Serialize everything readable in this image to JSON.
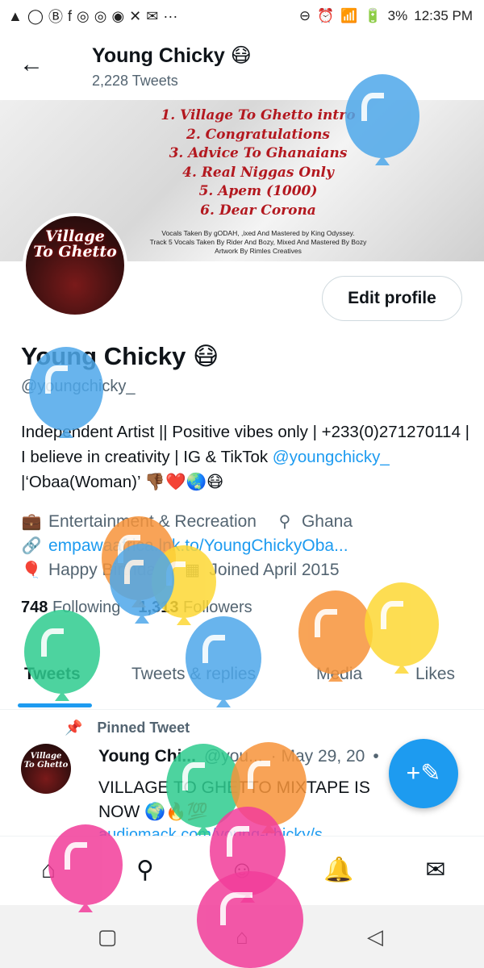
{
  "status_bar": {
    "left_icons": [
      "▲",
      "◯",
      "Ⓑ",
      "f",
      "◎",
      "◎",
      "◉",
      "✕",
      "✉",
      "···"
    ],
    "right_icons": [
      "⊖",
      "⏰",
      "📶",
      "🔋"
    ],
    "battery": "3%",
    "time": "12:35 PM"
  },
  "header": {
    "back_icon": "←",
    "title": "Young Chicky 😷",
    "tweet_count": "2,228 Tweets"
  },
  "banner": {
    "tracklist": [
      "1. Village To Ghetto intro",
      "2. Congratulations",
      "3. Advice To Ghanaians",
      "4. Real Niggas Only",
      "5. Apem (1000)",
      "6. Dear Corona"
    ],
    "credits": [
      "Vocals Taken By gODAH, ,ixed And Mastered by King Odyssey.",
      "Track 5 Vocals Taken By Rider And Bozy, Mixed And Mastered By Bozy",
      "Artwork By Rimles Creatives"
    ]
  },
  "avatar": {
    "cover_text": [
      "Village",
      "To Ghetto"
    ],
    "tweet_avatar_text": [
      "Village",
      "To Ghetto"
    ]
  },
  "profile": {
    "edit_button": "Edit profile",
    "name": "Young Chicky 😷",
    "handle": "@youngchicky_",
    "bio_text": "Independent Artist || Positive vibes only | +233(0)271270114 | I believe in creativity | IG & TikTok ",
    "bio_link": "@youngchicky_",
    "bio_end": " |‘Obaa(Woman)’ 👎🏾❤️🌏😷",
    "category_icon": "💼",
    "category": "Entertainment & Recreation",
    "location_icon": "⚲",
    "location": "Ghana",
    "link_icon": "🔗",
    "link": "empawaafrica.lnk.to/YoungChickyOba...",
    "birthday_icon": "🎈",
    "birthday": "Happy Birthday!",
    "joined_icon": "▦",
    "joined": "Joined April 2015",
    "following_count": "748",
    "following_label": "Following",
    "followers_count": "1,313",
    "followers_label": "Followers"
  },
  "tabs": [
    "Tweets",
    "Tweets & replies",
    "Media",
    "Likes"
  ],
  "pinned": {
    "pin_icon": "📌",
    "label": "Pinned Tweet",
    "author": "Young Chi...",
    "handle": "@you...",
    "date": "· May 29, 20",
    "more": "•",
    "text": "VILLAGE TO GHETTO MIXTAPE IS NOW 🌍🔥💯",
    "link": "audiomack.com/young-chicky/s..."
  },
  "fab_icon": "+✎",
  "bottom_nav": {
    "home": "⌂",
    "search": "⚲",
    "spaces": "☺",
    "notifications": "🔔",
    "messages": "✉"
  },
  "system_nav": {
    "recents": "▢",
    "home": "⌂",
    "back": "◁"
  },
  "balloon_colors": {
    "blue": "#4ea8ea",
    "orange": "#f7943a",
    "yellow": "#fdd835",
    "green": "#2ecc8f",
    "pink": "#f23d9a"
  }
}
